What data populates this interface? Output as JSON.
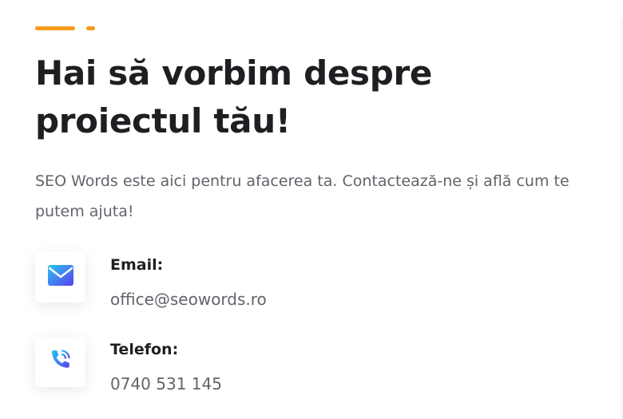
{
  "heading": "Hai să vorbim despre proiectul tău!",
  "intro": "SEO Words este aici pentru afacerea ta. Contactează-ne și află cum te putem ajuta!",
  "contacts": [
    {
      "label": "Email:",
      "value": "office@seowords.ro",
      "icon": "envelope-icon"
    },
    {
      "label": "Telefon:",
      "value": "0740 531 145",
      "icon": "phone-icon"
    }
  ],
  "colors": {
    "accent": "#f39a1e",
    "heading": "#1f1f23",
    "body_text": "#62646b",
    "icon_gradient_start": "#29c5ef",
    "icon_gradient_end": "#5b3ff0"
  }
}
